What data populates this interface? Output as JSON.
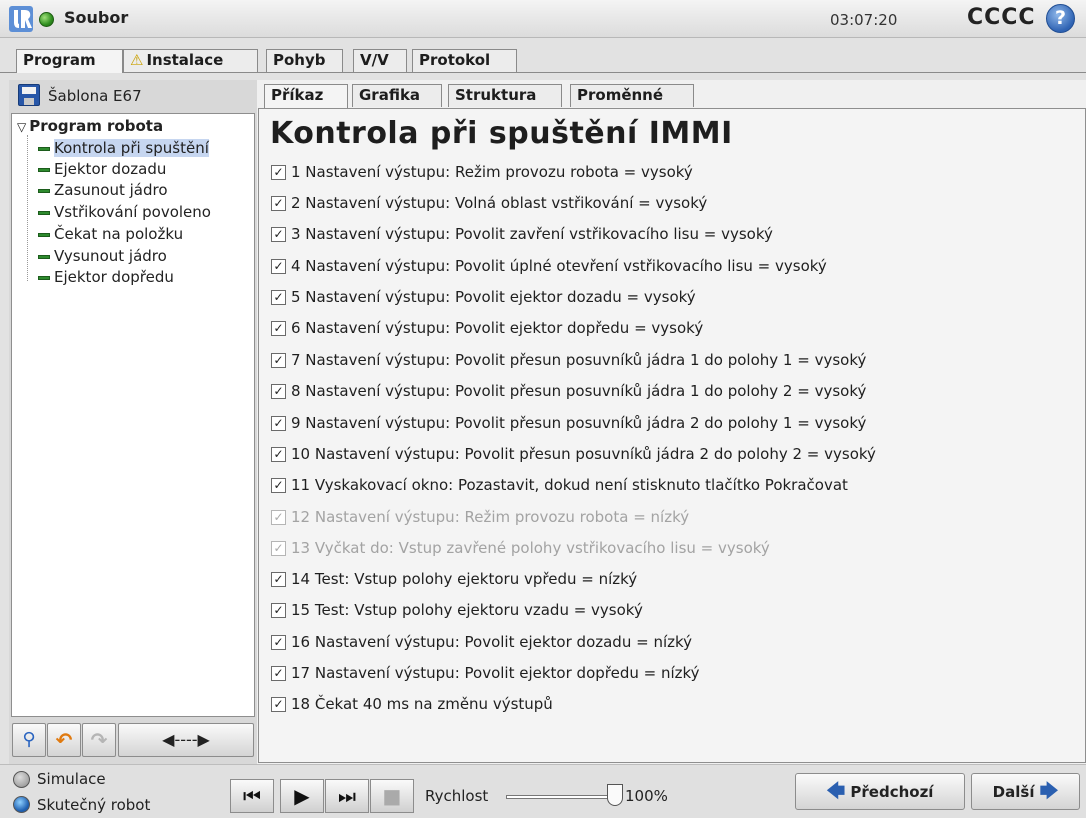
{
  "topbar": {
    "file_menu": "Soubor",
    "clock": "03:07:20",
    "robot_name": "CCCC",
    "help": "?"
  },
  "main_tabs": [
    {
      "label": "Program",
      "active": true
    },
    {
      "label": "Instalace",
      "warning": true
    },
    {
      "label": "Pohyb"
    },
    {
      "label": "V/V"
    },
    {
      "label": "Protokol"
    }
  ],
  "program": {
    "template": "Šablona E67",
    "root": "Program robota",
    "items": [
      {
        "label": "Kontrola při spuštění",
        "selected": true
      },
      {
        "label": "Ejektor dozadu"
      },
      {
        "label": "Zasunout jádro"
      },
      {
        "label": "Vstřikování povoleno"
      },
      {
        "label": "Čekat na položku"
      },
      {
        "label": "Vysunout jádro"
      },
      {
        "label": "Ejektor dopředu"
      }
    ]
  },
  "sub_tabs": [
    {
      "label": "Příkaz",
      "active": true
    },
    {
      "label": "Grafika"
    },
    {
      "label": "Struktura"
    },
    {
      "label": "Proměnné"
    }
  ],
  "content": {
    "title": "Kontrola při spuštění IMMI",
    "commands": [
      {
        "text": "1 Nastavení výstupu: Režim provozu robota = vysoký",
        "enabled": true
      },
      {
        "text": "2 Nastavení výstupu: Volná oblast vstřikování = vysoký",
        "enabled": true
      },
      {
        "text": "3 Nastavení výstupu: Povolit zavření vstřikovacího lisu = vysoký",
        "enabled": true
      },
      {
        "text": "4 Nastavení výstupu: Povolit úplné otevření vstřikovacího lisu = vysoký",
        "enabled": true
      },
      {
        "text": "5 Nastavení výstupu: Povolit ejektor dozadu = vysoký",
        "enabled": true
      },
      {
        "text": "6 Nastavení výstupu: Povolit ejektor dopředu = vysoký",
        "enabled": true
      },
      {
        "text": "7 Nastavení výstupu: Povolit přesun posuvníků jádra 1 do polohy 1 = vysoký",
        "enabled": true
      },
      {
        "text": "8 Nastavení výstupu: Povolit přesun posuvníků jádra 1 do polohy 2 = vysoký",
        "enabled": true
      },
      {
        "text": "9 Nastavení výstupu: Povolit přesun posuvníků jádra 2 do polohy 1 = vysoký",
        "enabled": true
      },
      {
        "text": "10 Nastavení výstupu: Povolit přesun posuvníků jádra 2 do polohy 2 = vysoký",
        "enabled": true
      },
      {
        "text": "11 Vyskakovací okno: Pozastavit, dokud není stisknuto tlačítko Pokračovat",
        "enabled": true
      },
      {
        "text": "12 Nastavení výstupu: Režim provozu robota = nízký",
        "enabled": false
      },
      {
        "text": "13 Vyčkat do: Vstup zavřené polohy vstřikovacího lisu = vysoký",
        "enabled": false
      },
      {
        "text": "14 Test: Vstup polohy ejektoru vpředu = nízký",
        "enabled": true
      },
      {
        "text": "15 Test: Vstup polohy ejektoru vzadu = vysoký",
        "enabled": true
      },
      {
        "text": "16 Nastavení výstupu: Povolit ejektor dozadu = nízký",
        "enabled": true
      },
      {
        "text": "17 Nastavení výstupu: Povolit ejektor dopředu = nízký",
        "enabled": true
      },
      {
        "text": "18 Čekat 40 ms na změnu výstupů",
        "enabled": true
      }
    ]
  },
  "bottom": {
    "simulation": "Simulace",
    "real_robot": "Skutečný robot",
    "speed_label": "Rychlost",
    "speed_value": "100%",
    "speed_fraction": 1.0,
    "prev": "Předchozí",
    "next": "Další"
  },
  "icons": {
    "tool_buttons": [
      "search-icon",
      "undo-icon",
      "redo-icon",
      "move-arrows-icon"
    ],
    "playback": [
      "skip-back-icon",
      "play-icon",
      "step-forward-icon",
      "stop-icon"
    ]
  }
}
